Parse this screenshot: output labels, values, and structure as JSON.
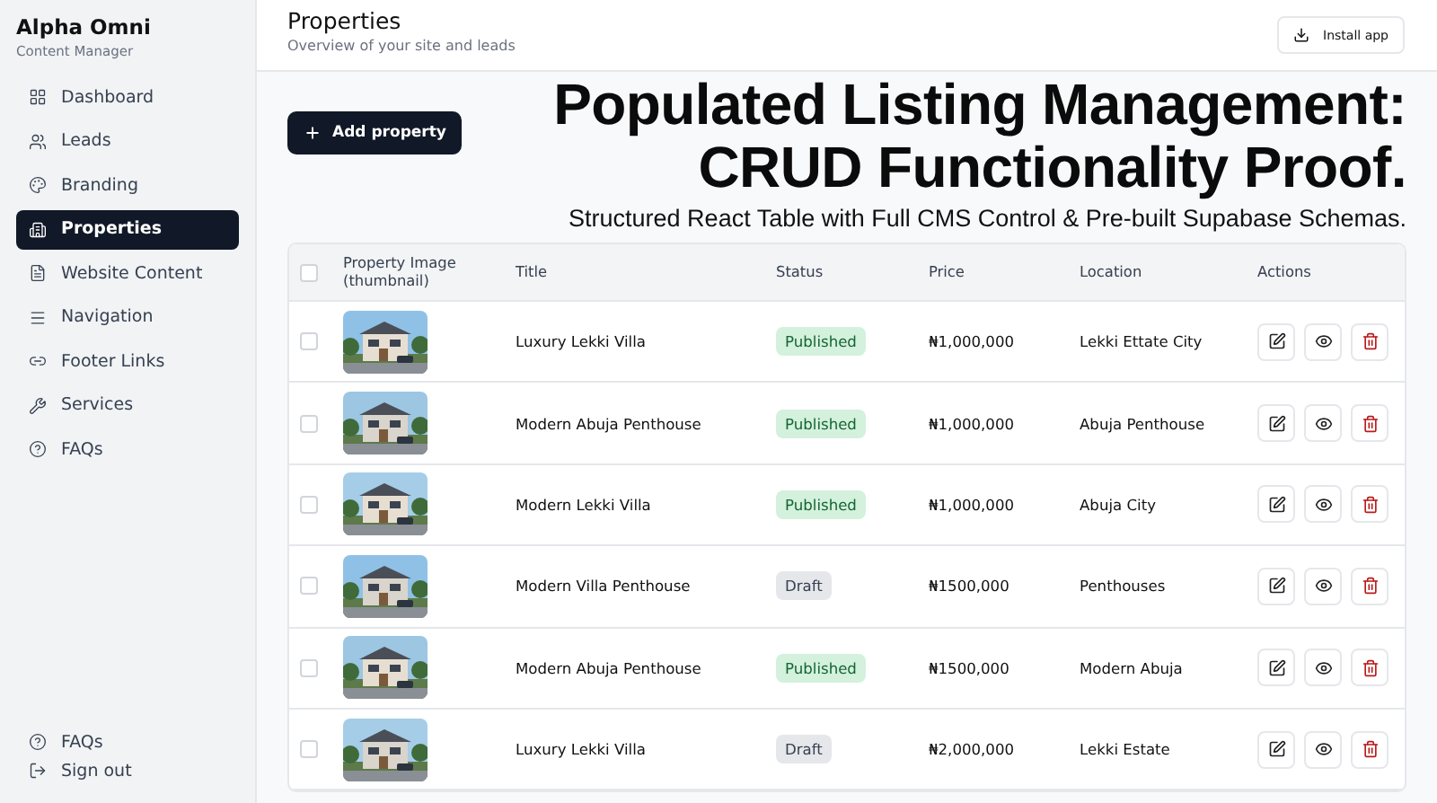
{
  "sidebar": {
    "brand": "Alpha Omni",
    "subtitle": "Content Manager",
    "items": [
      {
        "label": "Dashboard",
        "selected": false
      },
      {
        "label": "Leads",
        "selected": false
      },
      {
        "label": "Branding",
        "selected": false
      },
      {
        "label": "Properties",
        "selected": true
      },
      {
        "label": "Website Content",
        "selected": false
      },
      {
        "label": "Navigation",
        "selected": false
      },
      {
        "label": "Footer Links",
        "selected": false
      },
      {
        "label": "Services",
        "selected": false
      },
      {
        "label": "FAQs",
        "selected": false
      }
    ],
    "footer": [
      {
        "label": "FAQs"
      },
      {
        "label": "Sign out"
      }
    ]
  },
  "header": {
    "title": "Properties",
    "subtitle": "Overview of your site and leads",
    "install_button": "Install app"
  },
  "add_button": "Add property",
  "headline": {
    "lines": [
      "Populated Listing Management:",
      "CRUD Functionality Proof."
    ],
    "subtitle": "Structured React Table with Full CMS Control & Pre-built Supabase Schemas."
  },
  "table": {
    "all_checked": false,
    "columns": [
      "Property Image (thumbnail)",
      "Title",
      "Status",
      "Price",
      "Location",
      "Actions"
    ],
    "rows": [
      {
        "checked": false,
        "title": "Luxury Lekki Villa",
        "status": "Published",
        "kind": "published",
        "price": "₦1,000,000",
        "location": "Lekki Ettate City"
      },
      {
        "checked": false,
        "title": "Modern Abuja Penthouse",
        "status": "Published",
        "kind": "published",
        "price": "₦1,000,000",
        "location": "Abuja Penthouse"
      },
      {
        "checked": false,
        "title": "Modern Lekki Villa",
        "status": "Published",
        "kind": "published",
        "price": "₦1,000,000",
        "location": "Abuja City"
      },
      {
        "checked": false,
        "title": "Modern Villa Penthouse",
        "status": "Draft",
        "kind": "draft",
        "price": "₦1500,000",
        "location": "Penthouses"
      },
      {
        "checked": false,
        "title": "Modern Abuja Penthouse",
        "status": "Published",
        "kind": "published",
        "price": "₦1500,000",
        "location": "Modern Abuja"
      },
      {
        "checked": false,
        "title": "Luxury Lekki Villa",
        "status": "Draft",
        "kind": "draft",
        "price": "₦2,000,000",
        "location": "Lekki Estate"
      }
    ]
  }
}
